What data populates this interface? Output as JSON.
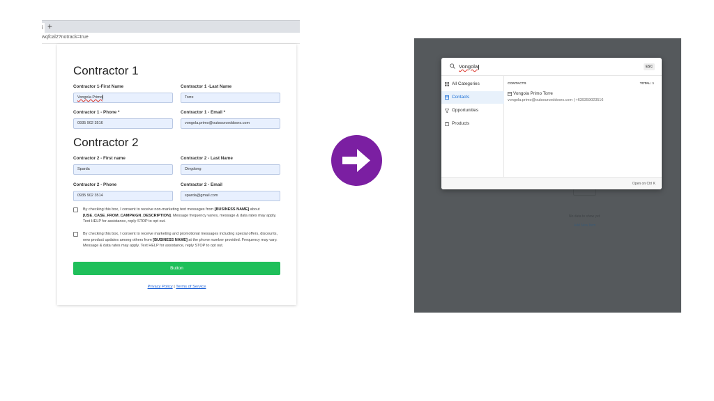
{
  "browser": {
    "tab_stub": "i",
    "new_tab": "+",
    "url": "wqfcal2?notrack=true"
  },
  "form": {
    "contractor1": {
      "title": "Contractor 1",
      "first_name_label": "Contractor 1-First Name",
      "first_name_value": "Vongola Primo",
      "last_name_label": "Contractor 1 -Last Name",
      "last_name_value": "Torre",
      "phone_label": "Contractor 1 - Phone *",
      "phone_value": "0935 902 3516",
      "email_label": "Contractor 1 - Email *",
      "email_value": "vongola.primo@outsourceddoors.com"
    },
    "contractor2": {
      "title": "Contractor 2",
      "first_name_label": "Contractor 2 - First name",
      "first_name_value": "Sparda",
      "last_name_label": "Contractor 2 - Last Name",
      "last_name_value": "Dingdong",
      "phone_label": "Contractor 2 - Phone",
      "phone_value": "0935 902 3514",
      "email_label": "Contractor 2 - Email",
      "email_value": "sparda@gmail.com"
    },
    "consent1": {
      "part1": "By checking this box, I consent to receive non-marketing text messages from ",
      "bold1": "[BUSINESS NAME]",
      "part2": " about ",
      "bold2": "[USE_CASE_FROM_CAMPAIGN_DESCRIPTION]",
      "part3": ". Message frequency varies, message & data rates may apply. Text HELP for assistance, reply STOP to opt out."
    },
    "consent2": {
      "part1": "By checking this box, I consent to receive marketing and promotional messages including special offers, discounts, new product updates among others from ",
      "bold1": "[BUSINESS NAME]",
      "part2": " at the phone number provided. Frequency may vary. Message & data rates may apply. Text HELP for assistance, reply STOP to opt out."
    },
    "button_label": "Button",
    "privacy_link": "Privacy Policy",
    "separator": " | ",
    "terms_link": "Terms of Service"
  },
  "search": {
    "query": "Vongola",
    "esc_label": "ESC",
    "categories": [
      {
        "label": "All Categories",
        "icon": "grid-icon",
        "active": false
      },
      {
        "label": "Contacts",
        "icon": "contact-card-icon",
        "active": true
      },
      {
        "label": "Opportunities",
        "icon": "funnel-icon",
        "active": false
      },
      {
        "label": "Products",
        "icon": "box-icon",
        "active": false
      }
    ],
    "results_header": "CONTACTS",
    "results_total": "TOTAL: 1",
    "result": {
      "name": "Vongola Primo Torre",
      "detail": "vongola.primo@outsourceddoors.com | +639359023516"
    },
    "footer_hint": "Open on  Ctrl K"
  },
  "background": {
    "ghost_text": "No data to show yet",
    "ghost_link": "Add New Item"
  },
  "colors": {
    "arrow_bg": "#7b1fa2",
    "button_green": "#1fbf5a",
    "input_bg": "#e8f0fe",
    "overlay": "#55595c",
    "active_category": "#1a6fd6"
  }
}
